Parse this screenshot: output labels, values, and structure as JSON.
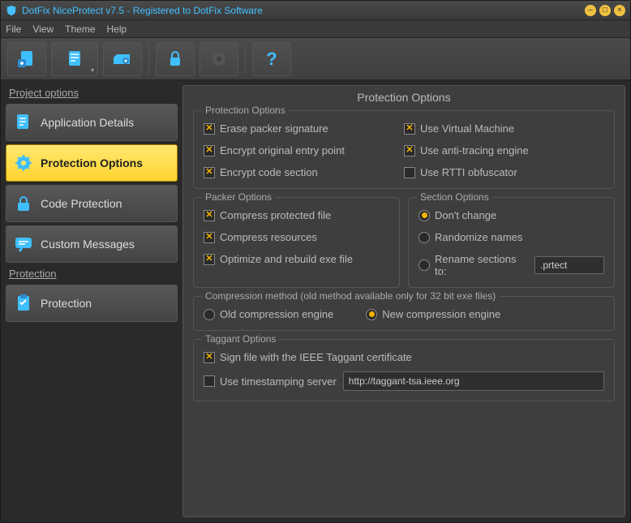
{
  "window": {
    "title": "DotFix NiceProtect v7.5 - Registered to DotFix Software"
  },
  "menu": [
    "File",
    "View",
    "Theme",
    "Help"
  ],
  "sidebar": {
    "project_title": "Project options",
    "project_items": [
      {
        "label": "Application Details"
      },
      {
        "label": "Protection Options",
        "active": true
      },
      {
        "label": "Code Protection"
      },
      {
        "label": "Custom Messages"
      }
    ],
    "protection_title": "Protection",
    "protection_items": [
      {
        "label": "Protection"
      }
    ]
  },
  "main": {
    "title": "Protection Options",
    "protection_options": {
      "legend": "Protection Options",
      "left": [
        {
          "label": "Erase packer signature",
          "checked": true
        },
        {
          "label": "Encrypt original entry point",
          "checked": true
        },
        {
          "label": "Encrypt code section",
          "checked": true
        }
      ],
      "right": [
        {
          "label": "Use Virtual Machine",
          "checked": true
        },
        {
          "label": "Use anti-tracing engine",
          "checked": true
        },
        {
          "label": "Use RTTI obfuscator",
          "checked": false
        }
      ]
    },
    "packer_options": {
      "legend": "Packer Options",
      "items": [
        {
          "label": "Compress protected file",
          "checked": true
        },
        {
          "label": "Compress resources",
          "checked": true
        },
        {
          "label": "Optimize and rebuild exe file",
          "checked": true
        }
      ]
    },
    "section_options": {
      "legend": "Section Options",
      "radios": [
        {
          "label": "Don't change",
          "checked": true
        },
        {
          "label": "Randomize names",
          "checked": false
        },
        {
          "label": "Rename sections to:",
          "checked": false
        }
      ],
      "rename_value": ".prtect"
    },
    "compression": {
      "legend": "Compression method (old method available only for 32 bit exe files)",
      "radios": [
        {
          "label": "Old compression engine",
          "checked": false
        },
        {
          "label": "New compression engine",
          "checked": true
        }
      ]
    },
    "taggant": {
      "legend": "Taggant Options",
      "sign": {
        "label": "Sign file with the IEEE Taggant certificate",
        "checked": true
      },
      "ts": {
        "label": "Use timestamping server",
        "checked": false
      },
      "ts_value": "http://taggant-tsa.ieee.org"
    }
  }
}
